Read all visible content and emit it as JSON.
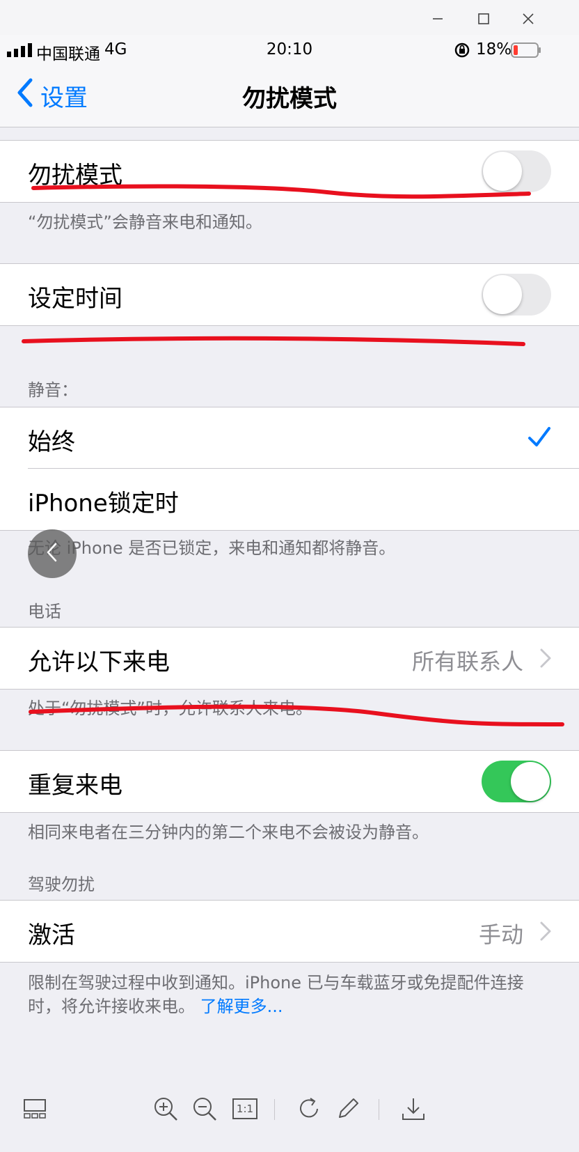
{
  "viewer": {
    "window_controls": [
      "minimize-icon",
      "maximize-icon",
      "close-icon"
    ]
  },
  "status_bar": {
    "carrier": "中国联通",
    "network": "4G",
    "time": "20:10",
    "battery_percent": "18%",
    "battery_level": 0.18
  },
  "nav": {
    "back_label": "设置",
    "title": "勿扰模式"
  },
  "dnd": {
    "label": "勿扰模式",
    "enabled": false,
    "footer": "“勿扰模式”会静音来电和通知。"
  },
  "scheduled": {
    "label": "设定时间",
    "enabled": false
  },
  "silence": {
    "header": "静音：",
    "options": [
      {
        "label": "始终",
        "selected": true
      },
      {
        "label": "iPhone锁定时",
        "selected": false
      }
    ],
    "footer": "无论 iPhone 是否已锁定，来电和通知都将静音。"
  },
  "phone": {
    "header": "电话",
    "allow_calls_label": "允许以下来电",
    "allow_calls_value": "所有联系人",
    "allow_calls_footer": "处于“勿扰模式”时，允许联系人来电。",
    "repeated_calls_label": "重复来电",
    "repeated_calls_enabled": true,
    "repeated_calls_footer": "相同来电者在三分钟内的第二个来电不会被设为静音。"
  },
  "driving": {
    "header": "驾驶勿扰",
    "activate_label": "激活",
    "activate_value": "手动",
    "footer": "限制在驾驶过程中收到通知。iPhone 已与车载蓝牙或免提配件连接时，将允许接收来电。",
    "learn_more": "了解更多..."
  },
  "toolbar": {
    "icons": [
      "thumbnails-icon",
      "zoom-in-icon",
      "zoom-out-icon",
      "actual-size-icon",
      "rotate-icon",
      "edit-icon",
      "download-icon"
    ],
    "actual_size_label": "1:1"
  },
  "colors": {
    "accent": "#007aff",
    "toggle_on": "#34c759",
    "annotation": "#e8101e"
  }
}
